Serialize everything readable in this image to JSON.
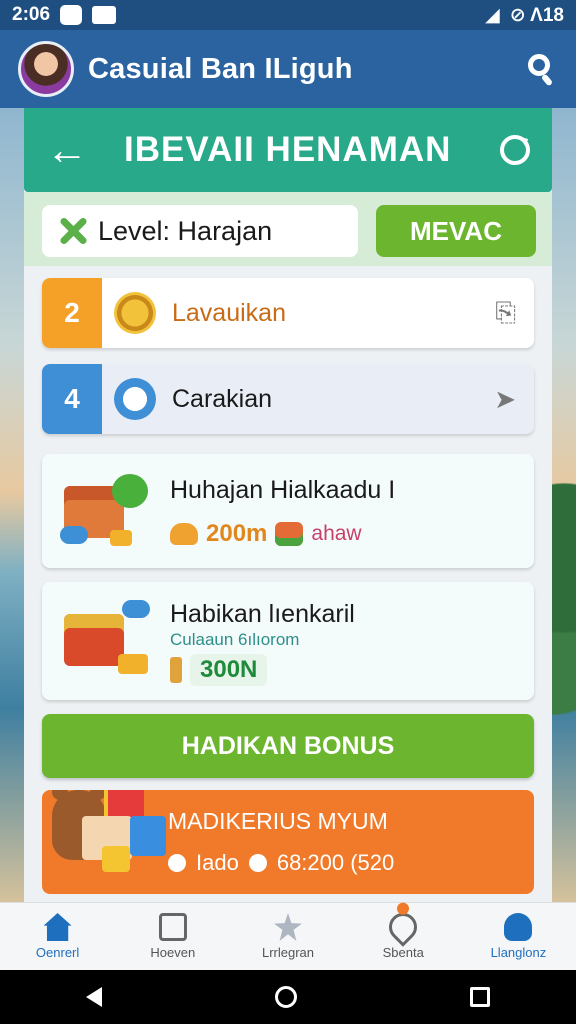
{
  "status_bar": {
    "time": "2:06",
    "right_text": "⊘ Λ18"
  },
  "app_bar": {
    "title": "Casuial Ban ILiguh"
  },
  "panel": {
    "title": "IBEVAII HENAMAN",
    "level_label": "Level: Harajan",
    "action_button": "MEVAC"
  },
  "ranks": [
    {
      "rank": "2",
      "label": "Lavauikan",
      "color": "#f5a128",
      "label_color": "#c96b16"
    },
    {
      "rank": "4",
      "label": "Carakian",
      "color": "#3f8fd6",
      "label_color": "#1a1a1a"
    }
  ],
  "rewards": [
    {
      "title": "Huhajan Hialkaadu I",
      "value": "200m",
      "extra": "ahaw"
    },
    {
      "title": "Habikan lıenkaril",
      "subtitle": "Culaaun 6ılıorom",
      "value": "300N"
    }
  ],
  "bonus_button": "HADIKAN BONUS",
  "promo": {
    "title": "MADIKERIUS MYUM",
    "left_text": "Iado",
    "right_text": "68:200 (520"
  },
  "bottom_nav": [
    {
      "label": "Oenrerl",
      "icon": "home-icon",
      "active": true
    },
    {
      "label": "Hoeven",
      "icon": "board-icon",
      "active": false
    },
    {
      "label": "Lrrlegran",
      "icon": "star-icon",
      "active": false
    },
    {
      "label": "Sbenta",
      "icon": "heart-icon",
      "active": false
    },
    {
      "label": "Llanglonz",
      "icon": "person-icon",
      "active": true
    }
  ]
}
